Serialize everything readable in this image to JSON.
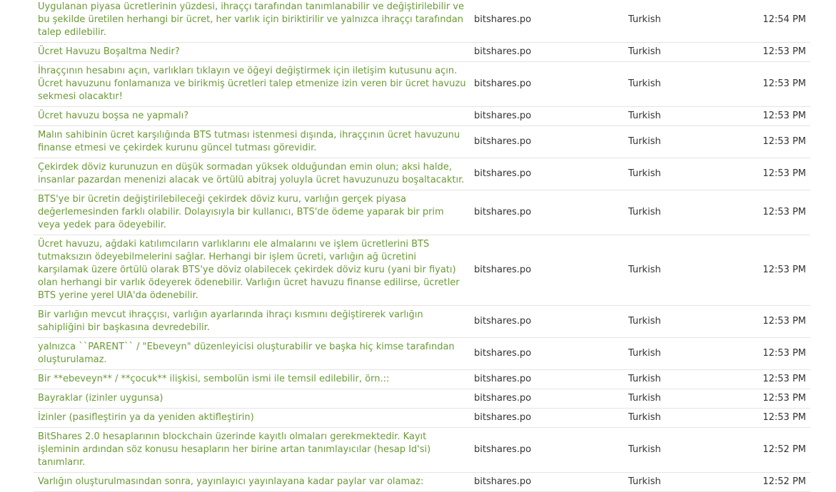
{
  "rows": [
    {
      "text": "Uygulanan piyasa ücretlerinin yüzdesi, ihraççı tarafından tanımlanabilir ve değiştirilebilir ve bu şekilde üretilen herhangi bir ücret, her varlık için biriktirilir ve yalnızca ihraççı tarafından talep edilebilir.",
      "project": "bitshares.po",
      "language": "Turkish",
      "time": "12:54 PM"
    },
    {
      "text": "Ücret Havuzu Boşaltma Nedir?",
      "project": "bitshares.po",
      "language": "Turkish",
      "time": "12:53 PM"
    },
    {
      "text": "İhraççının hesabını açın, varlıkları tıklayın ve öğeyi değiştirmek için iletişim kutusunu açın. Ücret havuzunu fonlamanıza ve birikmiş ücretleri talep etmenize izin veren bir ücret havuzu sekmesi olacaktır!",
      "project": "bitshares.po",
      "language": "Turkish",
      "time": "12:53 PM"
    },
    {
      "text": "Ücret havuzu boşsa ne yapmalı?",
      "project": "bitshares.po",
      "language": "Turkish",
      "time": "12:53 PM"
    },
    {
      "text": "Malın sahibinin ücret karşılığında BTS tutması istenmesi dışında, ihraççının ücret havuzunu finanse etmesi ve çekirdek kurunu güncel tutması görevidir.",
      "project": "bitshares.po",
      "language": "Turkish",
      "time": "12:53 PM"
    },
    {
      "text": "Çekirdek döviz kurunuzun en düşük sormadan yüksek olduğundan emin olun; aksi halde, insanlar pazardan menenizi alacak ve örtülü abitraj yoluyla ücret havuzunuzu boşaltacaktır.",
      "project": "bitshares.po",
      "language": "Turkish",
      "time": "12:53 PM"
    },
    {
      "text": "BTS'ye bir ücretin değiştirilebileceği çekirdek döviz kuru, varlığın gerçek piyasa değerlemesinden farklı olabilir. Dolayısıyla bir kullanıcı, BTS'de ödeme yaparak bir prim veya yedek para ödeyebilir.",
      "project": "bitshares.po",
      "language": "Turkish",
      "time": "12:53 PM"
    },
    {
      "text": "Ücret havuzu, ağdaki katılımcıların varlıklarını ele almalarını ve işlem ücretlerini BTS tutmaksızın ödeyebilmelerini sağlar. Herhangi bir işlem ücreti, varlığın ağ ücretini karşılamak üzere örtülü olarak BTS'ye döviz olabilecek çekirdek döviz kuru (yani bir fiyatı) olan herhangi bir varlık ödeyerek ödenebilir. Varlığın ücret havuzu finanse edilirse, ücretler BTS yerine yerel UIA'da ödenebilir.",
      "project": "bitshares.po",
      "language": "Turkish",
      "time": "12:53 PM"
    },
    {
      "text": "Bir varlığın mevcut ihraççısı, varlığın ayarlarında ihraçı kısmını değiştirerek varlığın sahipliğini bir başkasına devredebilir.",
      "project": "bitshares.po",
      "language": "Turkish",
      "time": "12:53 PM"
    },
    {
      "text": "yalnızca ``PARENT`` / \"Ebeveyn\" düzenleyicisi oluşturabilir ve başka hiç kimse tarafından oluşturulamaz.",
      "project": "bitshares.po",
      "language": "Turkish",
      "time": "12:53 PM"
    },
    {
      "text": "Bir **ebeveyn** / **çocuk** ilişkisi, sembolün ismi ile temsil edilebilir, örn.::",
      "project": "bitshares.po",
      "language": "Turkish",
      "time": "12:53 PM"
    },
    {
      "text": "Bayraklar (izinler uygunsa)",
      "project": "bitshares.po",
      "language": "Turkish",
      "time": "12:53 PM"
    },
    {
      "text": "İzinler (pasifleştirin ya da yeniden aktifleştirin)",
      "project": "bitshares.po",
      "language": "Turkish",
      "time": "12:53 PM"
    },
    {
      "text": "BitShares 2.0 hesaplarının blockchain üzerinde kayıtlı olmaları gerekmektedir. Kayıt işleminin ardından söz konusu hesapların her birine artan tanımlayıcılar (hesap Id'si) tanımlarır.",
      "project": "bitshares.po",
      "language": "Turkish",
      "time": "12:52 PM"
    },
    {
      "text": "Varlığın oluşturulmasından sonra, yayınlayıcı yayınlayana kadar paylar var olamaz:",
      "project": "bitshares.po",
      "language": "Turkish",
      "time": "12:52 PM"
    }
  ]
}
